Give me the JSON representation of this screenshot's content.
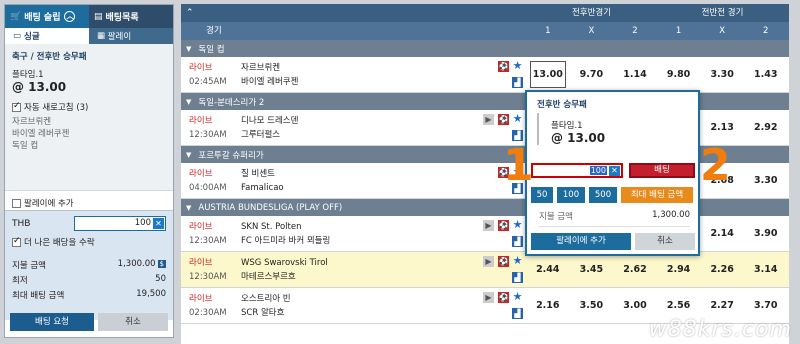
{
  "slip": {
    "tab_slip": "배팅 슬립",
    "tab_list": "배팅목록",
    "sub_single": "싱글",
    "sub_parlay": "팔레이",
    "selection_title": "축구 / 전후반 승무패",
    "selection_pick": "플타임.1",
    "selection_odds": "@ 13.00",
    "auto_refresh": "자동 새로고침 (3)",
    "team1": "자르브뤼켄",
    "team2": "바이엘 레버쿠젠",
    "league": "독일 컵",
    "add_parlay": "팔레이에 추가",
    "currency": "THB",
    "stake_value": "100",
    "better_odds": "더 나은 배당을 수락",
    "payout_label": "지불 금액",
    "payout_value": "1,300.00",
    "min_label": "최저",
    "min_value": "50",
    "max_label": "최대 배팅 금액",
    "max_value": "19,500",
    "request_btn": "배팅 요청",
    "cancel_btn": "취소"
  },
  "header": {
    "group1": "전후반경기",
    "group2": "전반전 경기",
    "league_col": "경기",
    "cols": [
      "1",
      "X",
      "2",
      "1",
      "X",
      "2"
    ]
  },
  "leagues": [
    {
      "name": "독일 컵",
      "matches": [
        {
          "live": "라이브",
          "time": "02:45AM",
          "home": "자르브뤼켄",
          "away": "바이엘 레버쿠젠",
          "odds": [
            "13.00",
            "9.70",
            "1.14",
            "9.80",
            "3.30",
            "1.43"
          ],
          "hl": false
        }
      ]
    },
    {
      "name": "독일-분데스리가 2",
      "matches": [
        {
          "live": "라이브",
          "time": "12:30AM",
          "home": "디나모 드레스덴",
          "away": "그루터펄스",
          "odds": [
            "",
            "",
            "",
            "",
            "2.13",
            "2.92"
          ],
          "hl": false
        }
      ]
    },
    {
      "name": "포르투갈 슈퍼리가",
      "matches": [
        {
          "live": "라이브",
          "time": "04:00AM",
          "home": "질 비센트",
          "away": "Famalicao",
          "odds": [
            "",
            "",
            "",
            "",
            "2.08",
            "3.30"
          ],
          "hl": false
        }
      ]
    },
    {
      "name": "AUSTRIA BUNDESLIGA (PLAY OFF)",
      "matches": [
        {
          "live": "라이브",
          "time": "12:30AM",
          "home": "SKN St. Polten",
          "away": "FC 아드미라 바커 뫼들링",
          "odds": [
            "",
            "",
            "",
            "",
            "2.14",
            "3.90"
          ],
          "hl": false
        },
        {
          "live": "라이브",
          "time": "12:30AM",
          "home": "WSG Swarovski Tirol",
          "away": "마테르스부르흐",
          "odds": [
            "2.44",
            "3.45",
            "2.62",
            "2.94",
            "2.26",
            "3.14"
          ],
          "hl": true
        },
        {
          "live": "라이브",
          "time": "02:30AM",
          "home": "오스트리아 빈",
          "away": "SCR 알타흐",
          "odds": [
            "2.16",
            "3.50",
            "3.00",
            "2.56",
            "2.27",
            "3.70"
          ],
          "hl": false
        }
      ]
    }
  ],
  "popup": {
    "title": "전후반 승무패",
    "pick": "플타임.1",
    "odds": "@ 13.00",
    "stake": "100",
    "bet_btn": "배팅",
    "chips": [
      "50",
      "100",
      "500"
    ],
    "max_btn": "최대 배팅 금액",
    "payout_label": "지불 금액",
    "payout_value": "1,300.00",
    "add_parlay_btn": "팔레이에 추가",
    "cancel_btn": "취소"
  },
  "annotations": [
    "1",
    "2"
  ],
  "watermark": "w88krs.com",
  "colors": {
    "accent": "#1c6c9e",
    "live": "#cc2222",
    "bet": "#c31f2c",
    "annot": "#f07d0e"
  }
}
